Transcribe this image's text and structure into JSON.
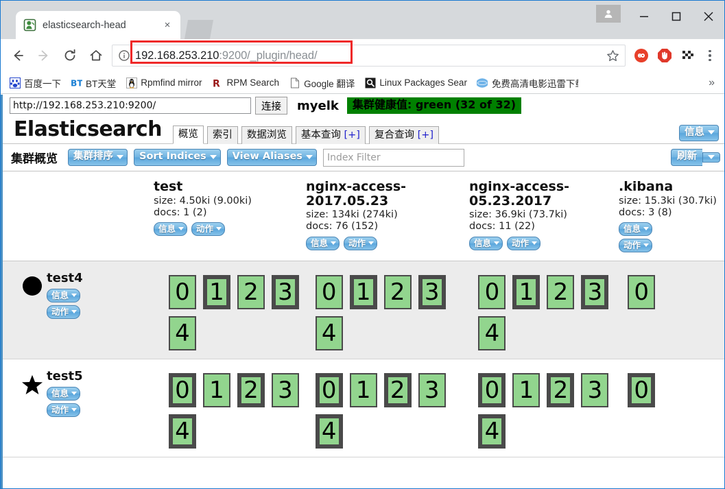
{
  "browser": {
    "tab": {
      "title": "elasticsearch-head",
      "favicon": "elasticsearch-head-icon",
      "close_label": "×"
    },
    "window_controls": {
      "profile": "profile-avatar",
      "minimize": "—",
      "maximize": "□",
      "close": "×"
    },
    "nav": {
      "back": "←",
      "forward": "→",
      "reload": "⟳",
      "home": "⌂"
    },
    "omnibox": {
      "host": "192.168.253.210",
      "rest": ":9200/_plugin/head/",
      "full_url": "192.168.253.210:9200/_plugin/head/",
      "site_info_icon": "info-circle-icon",
      "bookmark_icon": "star-icon",
      "annotation_color": "#ef2929"
    },
    "extensions": [
      {
        "name": "infinity-extension-icon",
        "color": "#e8402a"
      },
      {
        "name": "adblock-extension-icon",
        "color": "#e0392b"
      },
      {
        "name": "checkered-flag-extension-icon",
        "color": "#2b2b2b"
      }
    ],
    "menu": "chrome-menu-icon",
    "bookmarks": [
      {
        "label": "百度一下",
        "icon": "baidu-icon"
      },
      {
        "label": "BT天堂",
        "icon": "bt-icon"
      },
      {
        "label": "Rpmfind mirror",
        "icon": "tux-icon"
      },
      {
        "label": "RPM Search",
        "icon": "rpm-icon"
      },
      {
        "label": "Google 翻译",
        "icon": "document-icon"
      },
      {
        "label": "Linux Packages Sear",
        "icon": "search-icon"
      },
      {
        "label": "免费高清电影迅雷下载",
        "icon": "globe-icon"
      }
    ],
    "bookmarks_overflow": "»"
  },
  "app": {
    "connect": {
      "url_value": "http://192.168.253.210:9200/",
      "connect_button": "连接",
      "cluster_name": "myelk",
      "health_label": "集群健康值: green (32 of 32)",
      "health_color": "#008000"
    },
    "brand": "Elasticsearch",
    "tabs": [
      {
        "label": "概览",
        "active": true,
        "plus": ""
      },
      {
        "label": "索引",
        "active": false,
        "plus": ""
      },
      {
        "label": "数据浏览",
        "active": false,
        "plus": ""
      },
      {
        "label": "基本查询",
        "active": false,
        "plus": "[+]"
      },
      {
        "label": "复合查询",
        "active": false,
        "plus": "[+]"
      }
    ],
    "info_button": "信息",
    "toolbar": {
      "title": "集群概览",
      "sort_cluster": "集群排序",
      "sort_indices": "Sort Indices",
      "view_aliases": "View Aliases",
      "index_filter_placeholder": "Index Filter",
      "index_filter_value": "",
      "refresh": "刷新"
    },
    "row_buttons": {
      "info": "信息",
      "action": "动作"
    },
    "indices": [
      {
        "name": "test",
        "size": "size: 4.50ki (9.00ki)",
        "docs": "docs: 1 (2)",
        "stacked_buttons": false
      },
      {
        "name": "nginx-access-2017.05.23",
        "size": "size: 134ki (274ki)",
        "docs": "docs: 76 (152)",
        "stacked_buttons": false
      },
      {
        "name": "nginx-access-05.23.2017",
        "size": "size: 36.9ki (73.7ki)",
        "docs": "docs: 11 (22)",
        "stacked_buttons": false
      },
      {
        "name": ".kibana",
        "size": "size: 15.3ki (30.7ki)",
        "docs": "docs: 3 (8)",
        "stacked_buttons": true
      }
    ],
    "nodes": [
      {
        "name": "test4",
        "marker": "circle",
        "shard_sets": [
          [
            {
              "n": "0",
              "primary": false
            },
            {
              "n": "1",
              "primary": true
            },
            {
              "n": "2",
              "primary": false
            },
            {
              "n": "3",
              "primary": true
            },
            {
              "n": "4",
              "primary": false
            }
          ],
          [
            {
              "n": "0",
              "primary": false
            },
            {
              "n": "1",
              "primary": true
            },
            {
              "n": "2",
              "primary": false
            },
            {
              "n": "3",
              "primary": true
            },
            {
              "n": "4",
              "primary": false
            }
          ],
          [
            {
              "n": "0",
              "primary": false
            },
            {
              "n": "1",
              "primary": true
            },
            {
              "n": "2",
              "primary": false
            },
            {
              "n": "3",
              "primary": true
            },
            {
              "n": "4",
              "primary": false
            }
          ],
          [
            {
              "n": "0",
              "primary": false
            }
          ]
        ]
      },
      {
        "name": "test5",
        "marker": "star",
        "shard_sets": [
          [
            {
              "n": "0",
              "primary": true
            },
            {
              "n": "1",
              "primary": false
            },
            {
              "n": "2",
              "primary": true
            },
            {
              "n": "3",
              "primary": false
            },
            {
              "n": "4",
              "primary": true
            }
          ],
          [
            {
              "n": "0",
              "primary": true
            },
            {
              "n": "1",
              "primary": false
            },
            {
              "n": "2",
              "primary": true
            },
            {
              "n": "3",
              "primary": false
            },
            {
              "n": "4",
              "primary": true
            }
          ],
          [
            {
              "n": "0",
              "primary": true
            },
            {
              "n": "1",
              "primary": false
            },
            {
              "n": "2",
              "primary": true
            },
            {
              "n": "3",
              "primary": false
            },
            {
              "n": "4",
              "primary": true
            }
          ],
          [
            {
              "n": "0",
              "primary": true
            }
          ]
        ]
      }
    ],
    "shard_color": "#92d58e"
  }
}
